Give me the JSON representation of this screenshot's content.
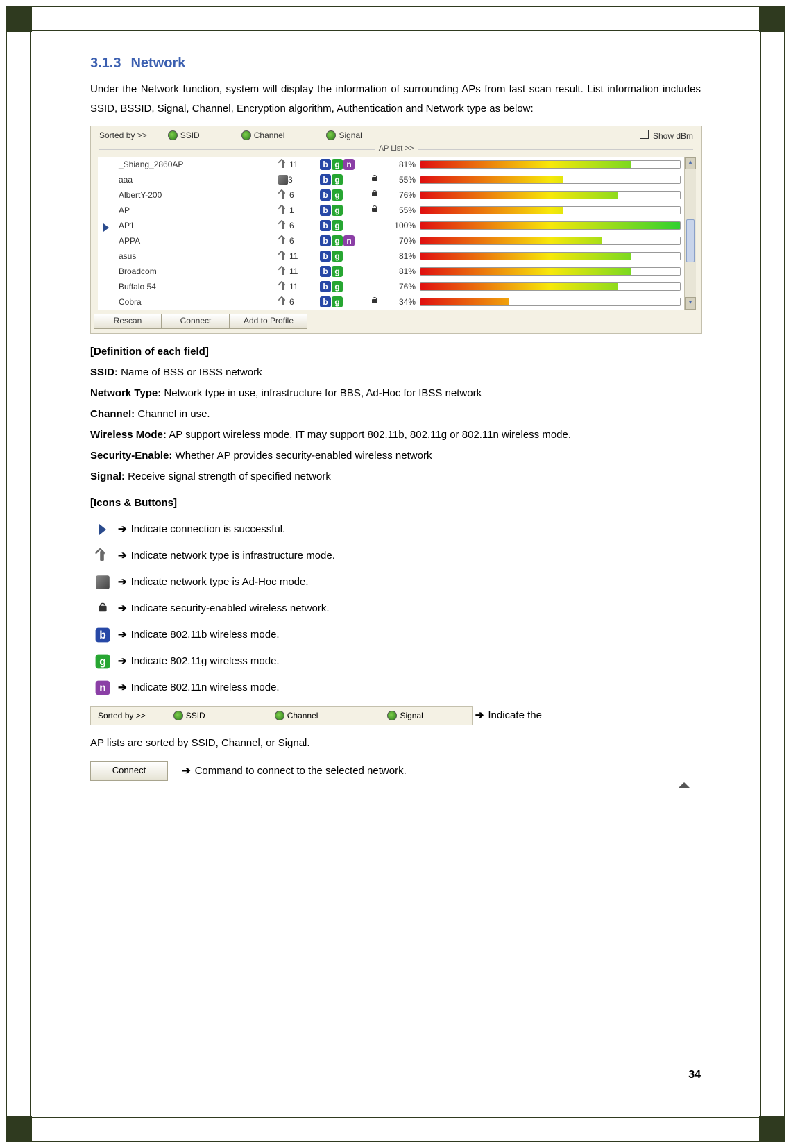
{
  "heading": {
    "number": "3.1.3",
    "title": "Network"
  },
  "intro": "Under the Network function, system will display the information of surrounding APs from last scan result. List information includes SSID, BSSID, Signal, Channel, Encryption algorithm, Authentication and Network type as below:",
  "panel": {
    "sorted_by": "Sorted by >>",
    "ssid": "SSID",
    "channel": "Channel",
    "signal": "Signal",
    "show_dbm": "Show dBm",
    "ap_list": "AP List >>",
    "buttons": {
      "rescan": "Rescan",
      "connect": "Connect",
      "add": "Add to Profile"
    },
    "rows": [
      {
        "ssid": "_Shiang_2860AP",
        "adhoc": false,
        "ch": 11,
        "modes": [
          "b",
          "g",
          "n"
        ],
        "sec": false,
        "pct": 81,
        "sel": false
      },
      {
        "ssid": "aaa",
        "adhoc": true,
        "ch": 3,
        "modes": [
          "b",
          "g"
        ],
        "sec": true,
        "pct": 55,
        "sel": false
      },
      {
        "ssid": "AlbertY-200",
        "adhoc": false,
        "ch": 6,
        "modes": [
          "b",
          "g"
        ],
        "sec": true,
        "pct": 76,
        "sel": false
      },
      {
        "ssid": "AP",
        "adhoc": false,
        "ch": 1,
        "modes": [
          "b",
          "g"
        ],
        "sec": true,
        "pct": 55,
        "sel": false
      },
      {
        "ssid": "AP1",
        "adhoc": false,
        "ch": 6,
        "modes": [
          "b",
          "g"
        ],
        "sec": false,
        "pct": 100,
        "sel": true
      },
      {
        "ssid": "APPA",
        "adhoc": false,
        "ch": 6,
        "modes": [
          "b",
          "g",
          "n"
        ],
        "sec": false,
        "pct": 70,
        "sel": false
      },
      {
        "ssid": "asus",
        "adhoc": false,
        "ch": 11,
        "modes": [
          "b",
          "g"
        ],
        "sec": false,
        "pct": 81,
        "sel": false
      },
      {
        "ssid": "Broadcom",
        "adhoc": false,
        "ch": 11,
        "modes": [
          "b",
          "g"
        ],
        "sec": false,
        "pct": 81,
        "sel": false
      },
      {
        "ssid": "Buffalo 54",
        "adhoc": false,
        "ch": 11,
        "modes": [
          "b",
          "g"
        ],
        "sec": false,
        "pct": 76,
        "sel": false
      },
      {
        "ssid": "Cobra",
        "adhoc": false,
        "ch": 6,
        "modes": [
          "b",
          "g"
        ],
        "sec": true,
        "pct": 34,
        "sel": false
      }
    ]
  },
  "defs_header": "[Definition of each field]",
  "defs": {
    "ssid_l": "SSID:",
    "ssid_t": " Name of BSS or IBSS network",
    "nt_l": "Network Type:",
    "nt_t": " Network type in use, infrastructure for BBS, Ad-Hoc for IBSS network",
    "ch_l": "Channel:",
    "ch_t": " Channel in use.",
    "wm_l": "Wireless Mode:",
    "wm_t": " AP support wireless mode. IT may support 802.11b, 802.11g or 802.11n wireless mode.",
    "se_l": "Security-Enable:",
    "se_t": " Whether AP provides security-enabled wireless network",
    "sg_l": "Signal:",
    "sg_t": " Receive signal strength of specified network"
  },
  "icons_header": "[Icons & Buttons]",
  "icons": {
    "conn": "Indicate connection is successful.",
    "infra": "Indicate network type is infrastructure mode.",
    "adhoc": "Indicate network type is Ad-Hoc mode.",
    "sec": "Indicate security-enabled wireless network.",
    "b": "Indicate 802.11b wireless mode.",
    "g": "Indicate 802.11g wireless mode.",
    "n": "Indicate 802.11n wireless mode.",
    "sort_pre": "Indicate the",
    "sort_post": "AP lists are sorted by SSID, Channel, or Signal.",
    "connect_label": "Connect",
    "connect_desc": "Command to connect to the selected network."
  },
  "arrow": "➔",
  "page_number": "34"
}
